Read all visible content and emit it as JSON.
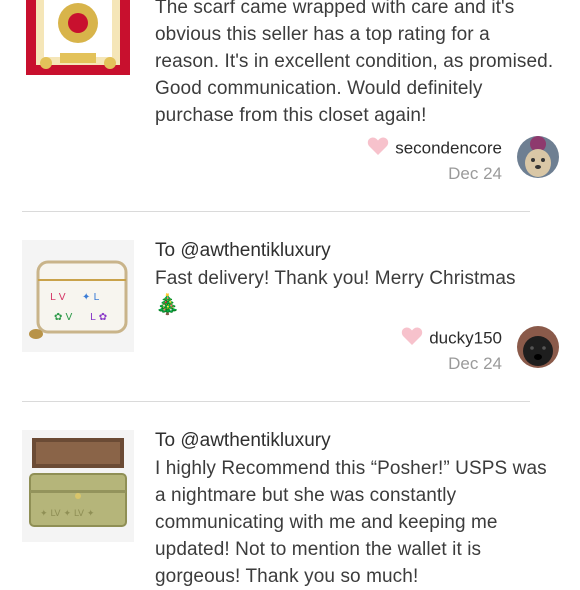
{
  "reviews": [
    {
      "recipient": "",
      "text": "The scarf came wrapped with care and it's obvious this seller has a top rating for a reason. It's in excellent condition, as promised. Good communication. Would definitely purchase from this closet again!",
      "username": "secondencore",
      "date": "Dec 24",
      "thumb_icon": "scarf-image",
      "avatar_icon": "dog-avatar"
    },
    {
      "recipient": "To @awthentikluxury",
      "text": "Fast delivery! Thank you! Merry Christmas",
      "emoji": "🎄",
      "username": "ducky150",
      "date": "Dec 24",
      "thumb_icon": "coin-purse-image",
      "avatar_icon": "black-dog-avatar"
    },
    {
      "recipient": "To @awthentikluxury",
      "text": "I highly Recommend this “Posher!” USPS was a nightmare but she was constantly communicating with me and keeping me updated! Not to mention the wallet it is gorgeous! Thank you so much!",
      "thumb_icon": "wallet-image"
    }
  ],
  "colors": {
    "heart": "#f7c2cc",
    "date": "#9a9a9a",
    "divider": "#dadada"
  }
}
